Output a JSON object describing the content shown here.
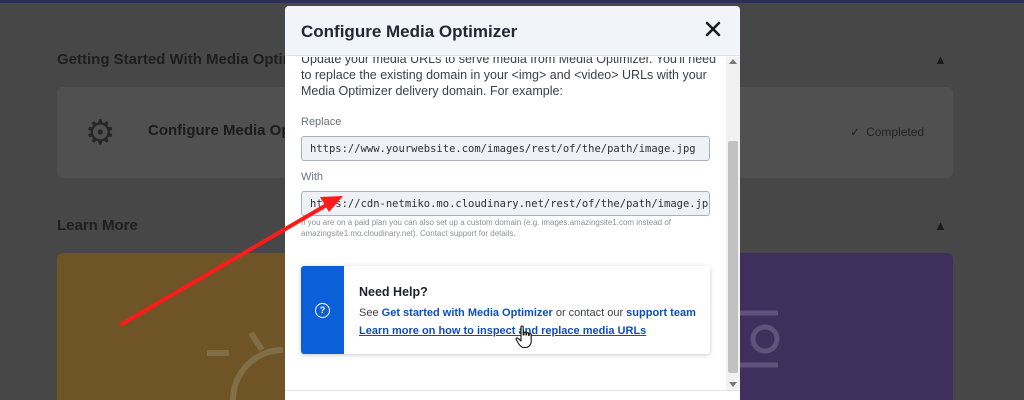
{
  "background": {
    "sections": [
      {
        "title": "Getting Started With Media Optim"
      },
      {
        "title": "Learn More"
      }
    ],
    "card": {
      "title": "Configure Media Opt",
      "status": "Completed"
    }
  },
  "modal": {
    "title": "Configure Media Optimizer",
    "intro": "Update your media URLs to serve media from Media Optimizer. You'll need to replace the existing domain in your <img> and <video> URLs with your Media Optimizer delivery domain. For example:",
    "replace_label": "Replace",
    "replace_url": "https://www.yourwebsite.com/images/rest/of/the/path/image.jpg",
    "with_label": "With",
    "with_url": "https://cdn-netmiko.mo.cloudinary.net/rest/of/the/path/image.jpg",
    "hint": "If you are on a paid plan you can also set up a custom domain (e.g. images.amazingsite1.com instead of amazingsite1.mo.cloudinary.net). Contact support for details.",
    "help": {
      "title": "Need Help?",
      "see": "See",
      "link1": "Get started with Media Optimizer",
      "middle": "or contact our",
      "link2": "support team",
      "link3": "Learn more on how to inspect and replace media URLs"
    }
  },
  "colors": {
    "accent_blue": "#0b5fd9",
    "link_blue": "#0b4fbd",
    "overlay": "#474747",
    "annotation_arrow": "#ff1a1a"
  },
  "icons": [
    "gear-icon",
    "check-icon",
    "chevron-up-icon",
    "close-icon",
    "question-icon",
    "hand-cursor-icon"
  ]
}
